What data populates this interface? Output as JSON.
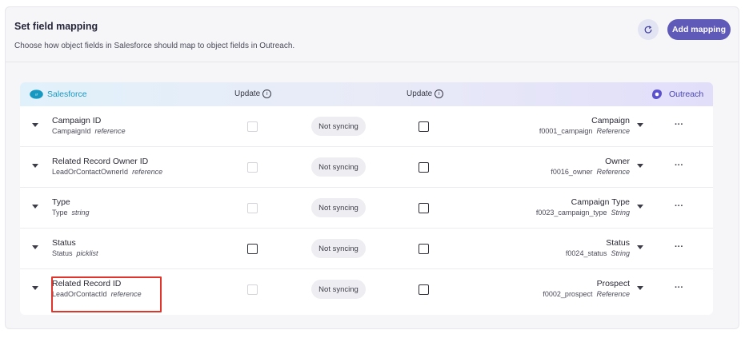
{
  "header": {
    "title": "Set field mapping",
    "subtitle": "Choose how object fields in Salesforce should map to object fields in Outreach.",
    "add_mapping_label": "Add mapping"
  },
  "table_header": {
    "salesforce_label": "Salesforce",
    "update_left_label": "Update",
    "update_right_label": "Update",
    "outreach_label": "Outreach"
  },
  "rows": [
    {
      "field": "Campaign ID",
      "api": "CampaignId",
      "type": "reference",
      "left_checked": false,
      "sync": "Not syncing",
      "right_checked": false,
      "target": "Campaign",
      "target_api": "f0001_campaign",
      "target_type": "Reference"
    },
    {
      "field": "Related Record Owner ID",
      "api": "LeadOrContactOwnerId",
      "type": "reference",
      "left_checked": false,
      "sync": "Not syncing",
      "right_checked": false,
      "target": "Owner",
      "target_api": "f0016_owner",
      "target_type": "Reference"
    },
    {
      "field": "Type",
      "api": "Type",
      "type": "string",
      "left_checked": false,
      "sync": "Not syncing",
      "right_checked": false,
      "target": "Campaign Type",
      "target_api": "f0023_campaign_type",
      "target_type": "String"
    },
    {
      "field": "Status",
      "api": "Status",
      "type": "picklist",
      "left_checked": false,
      "sync": "Not syncing",
      "right_checked": false,
      "target": "Status",
      "target_api": "f0024_status",
      "target_type": "String"
    },
    {
      "field": "Related Record ID",
      "api": "LeadOrContactId",
      "type": "reference",
      "left_checked": false,
      "sync": "Not syncing",
      "right_checked": false,
      "target": "Prospect",
      "target_api": "f0002_prospect",
      "target_type": "Reference"
    }
  ],
  "icons": {
    "refresh": "refresh-icon",
    "info": "info-icon",
    "row_expand": "chevron-down-icon",
    "more": "more-options-icon",
    "salesforce": "salesforce-logo",
    "outreach": "outreach-logo"
  },
  "colors": {
    "accent": "#5f59b7",
    "salesforce": "#1798c1",
    "outreach": "#4a45b0",
    "highlight": "#e0352b"
  }
}
